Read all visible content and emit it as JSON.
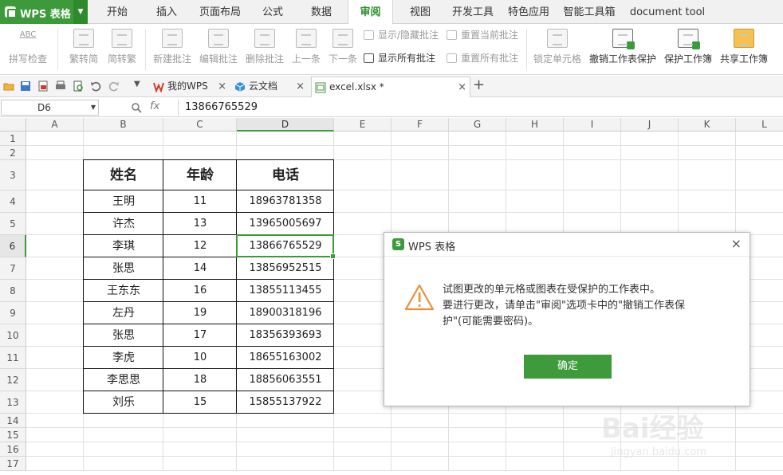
{
  "app": {
    "name": "WPS 表格"
  },
  "menu": {
    "tabs": [
      "开始",
      "插入",
      "页面布局",
      "公式",
      "数据",
      "审阅",
      "视图",
      "开发工具",
      "特色应用",
      "智能工具箱",
      "document tool"
    ],
    "active": "审阅"
  },
  "ribbon": {
    "spell_check": "拼写检查",
    "spell_check_icon_text": "ABC",
    "trad_to_simp": "繁转简",
    "simp_to_trad": "简转繁",
    "new_comment": "新建批注",
    "edit_comment": "编辑批注",
    "delete_comment": "删除批注",
    "prev": "上一条",
    "next": "下一条",
    "show_hide_comment": "显示/隐藏批注",
    "show_all_comments": "显示所有批注",
    "reset_current_comment": "重置当前批注",
    "reset_all_comments": "重置所有批注",
    "lock_cell": "锁定单元格",
    "unprotect_sheet": "撤销工作表保护",
    "protect_workbook": "保护工作簿",
    "share_workbook": "共享工作簿"
  },
  "doc_tabs": [
    {
      "label": "我的WPS"
    },
    {
      "label": "云文档"
    },
    {
      "label": "excel.xlsx *"
    }
  ],
  "formula_bar": {
    "cell_ref": "D6",
    "fx": "fx",
    "value": "13866765529"
  },
  "sheet": {
    "columns": [
      "A",
      "B",
      "C",
      "D",
      "E",
      "F",
      "G",
      "H",
      "I",
      "J",
      "K",
      "L"
    ],
    "rows": [
      "1",
      "2",
      "3",
      "4",
      "5",
      "6",
      "7",
      "8",
      "9",
      "10",
      "11",
      "12",
      "13",
      "14",
      "15",
      "16",
      "17"
    ],
    "selected_cell": "D6",
    "table_headers": [
      "姓名",
      "年龄",
      "电话"
    ],
    "table_rows": [
      [
        "王明",
        "11",
        "18963781358"
      ],
      [
        "许杰",
        "13",
        "13965005697"
      ],
      [
        "李琪",
        "12",
        "13866765529"
      ],
      [
        "张思",
        "14",
        "13856952515"
      ],
      [
        "王东东",
        "16",
        "13855113455"
      ],
      [
        "左丹",
        "19",
        "18900318196"
      ],
      [
        "张思",
        "17",
        "18356393693"
      ],
      [
        "李虎",
        "10",
        "18655163002"
      ],
      [
        "李思思",
        "18",
        "18856063551"
      ],
      [
        "刘乐",
        "15",
        "15855137922"
      ]
    ]
  },
  "dialog": {
    "title": "WPS 表格",
    "logo_letter": "S",
    "line1": "试图更改的单元格或图表在受保护的工作表中。",
    "line2": "要进行更改，请单击\"审阅\"选项卡中的\"撤销工作表保",
    "line3": "护\"(可能需要密码)。",
    "ok": "确定",
    "close": "×"
  },
  "watermark": {
    "brand": "Bai经验",
    "url": "jingyan.baidu.com"
  },
  "colors": {
    "accent": "#3d9a3b",
    "warning": "#e8913a"
  }
}
